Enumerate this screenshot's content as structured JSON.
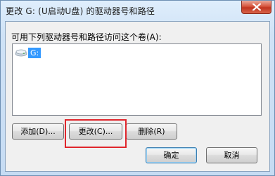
{
  "window": {
    "title": "更改 G: (U启动U盘) 的驱动器号和路径",
    "close_icon": "close-icon"
  },
  "list": {
    "label": "可用下列驱动器号和路径访问这个卷(A):",
    "items": [
      {
        "icon": "drive-icon",
        "label": "G:"
      }
    ]
  },
  "buttons": {
    "add": "添加(D)...",
    "change": "更改(C)...",
    "delete": "删除(R)",
    "ok": "确定",
    "cancel": "取消"
  },
  "colors": {
    "selection": "#3399ff",
    "highlight_box": "#e0262c",
    "close_button": "#c0351f"
  }
}
